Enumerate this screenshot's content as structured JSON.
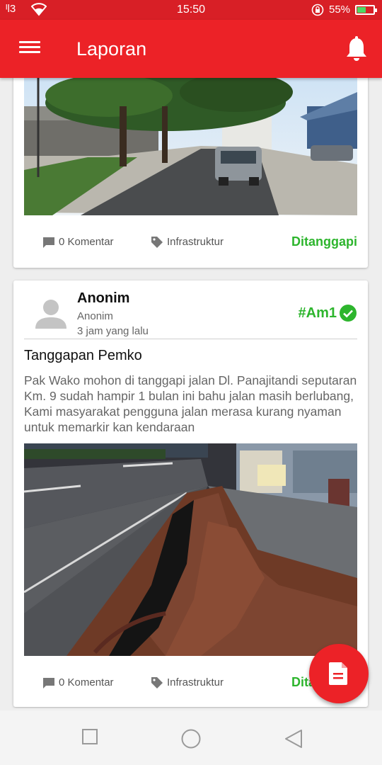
{
  "status_bar": {
    "signal": "ᴵl3",
    "time": "15:50",
    "battery": "55%",
    "battery_level": 0.55
  },
  "app_bar": {
    "title": "Laporan",
    "menu_icon": "hamburger-menu-icon",
    "notification_icon": "bell-icon"
  },
  "posts": [
    {
      "comments": "0 Komentar",
      "category": "Infrastruktur",
      "status": "Ditanggapi"
    },
    {
      "author": "Anonim",
      "author_sub": "Anonim",
      "time_ago": "3 jam yang lalu",
      "report_id": "#Am1",
      "title": "Tanggapan Pemko",
      "body": "Pak Wako mohon di tanggapi jalan Dl. Panajitandi seputaran Km. 9 sudah hampir 1 bulan ini bahu jalan masih berlubang, Kami masyarakat pengguna jalan merasa kurang nyaman untuk memarkir kan kendaraan",
      "comments": "0 Komentar",
      "category": "Infrastruktur",
      "status": "Ditanggapi"
    }
  ],
  "fab": {
    "icon": "document-icon"
  },
  "colors": {
    "primary": "#ec2227",
    "success": "#2db52d"
  }
}
